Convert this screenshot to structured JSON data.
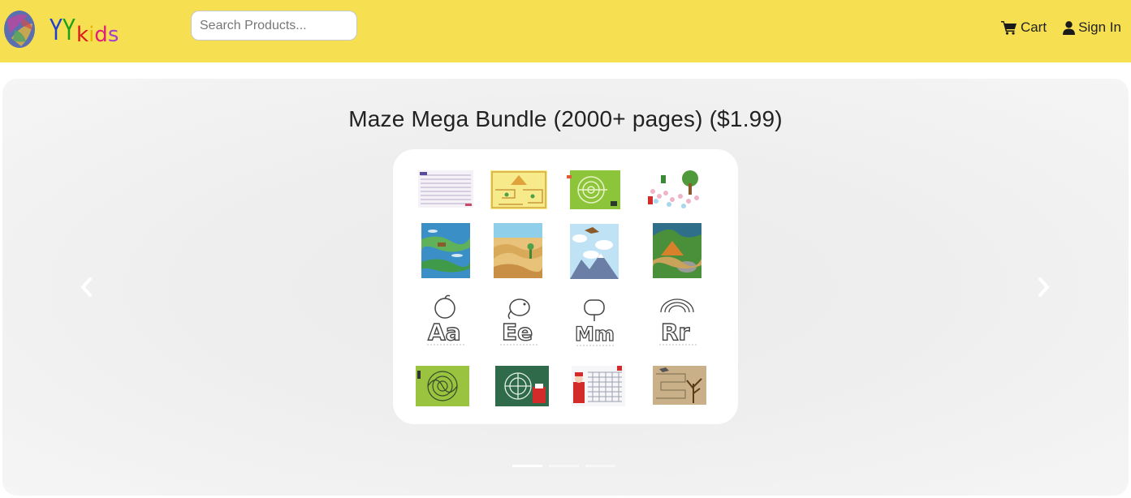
{
  "brand": {
    "name": "YYkids",
    "letters": [
      {
        "char": "Y",
        "color": "#1e3fd6"
      },
      {
        "char": "Y",
        "color": "#1aa01a"
      },
      {
        "char": "k",
        "color": "#d81a1a"
      },
      {
        "char": "i",
        "color": "#e8b300"
      },
      {
        "char": "d",
        "color": "#e01f7a"
      },
      {
        "char": "s",
        "color": "#a33fd0"
      }
    ],
    "logo_icon": "painted-stone-logo"
  },
  "search": {
    "placeholder": "Search Products..."
  },
  "nav": {
    "cart": {
      "label": "Cart",
      "icon": "cart-icon"
    },
    "signin": {
      "label": "Sign In",
      "icon": "user-icon"
    }
  },
  "carousel": {
    "title": "Maze Mega Bundle (2000+ pages) ($1.99)",
    "prev_icon": "chevron-left-icon",
    "next_icon": "chevron-right-icon",
    "slide_count": 3,
    "active_index": 0,
    "thumbnails": [
      "text-maze-thumbnail",
      "desert-pyramid-maze-thumbnail",
      "green-maze-thumbnail",
      "forest-path-maze-thumbnail",
      "river-maze-thumbnail",
      "desert-dune-maze-thumbnail",
      "mountain-bird-maze-thumbnail",
      "jungle-maze-thumbnail",
      "apple-letter-a-thumbnail",
      "elephant-letter-e-thumbnail",
      "mailbox-letter-m-thumbnail",
      "rainbow-letter-r-thumbnail",
      "green-tangle-maze-thumbnail",
      "santa-chimney-maze-thumbnail",
      "santa-snow-maze-thumbnail",
      "bird-tree-maze-thumbnail"
    ]
  },
  "colors": {
    "navbar": "#f6df51",
    "card": "#ffffff"
  }
}
